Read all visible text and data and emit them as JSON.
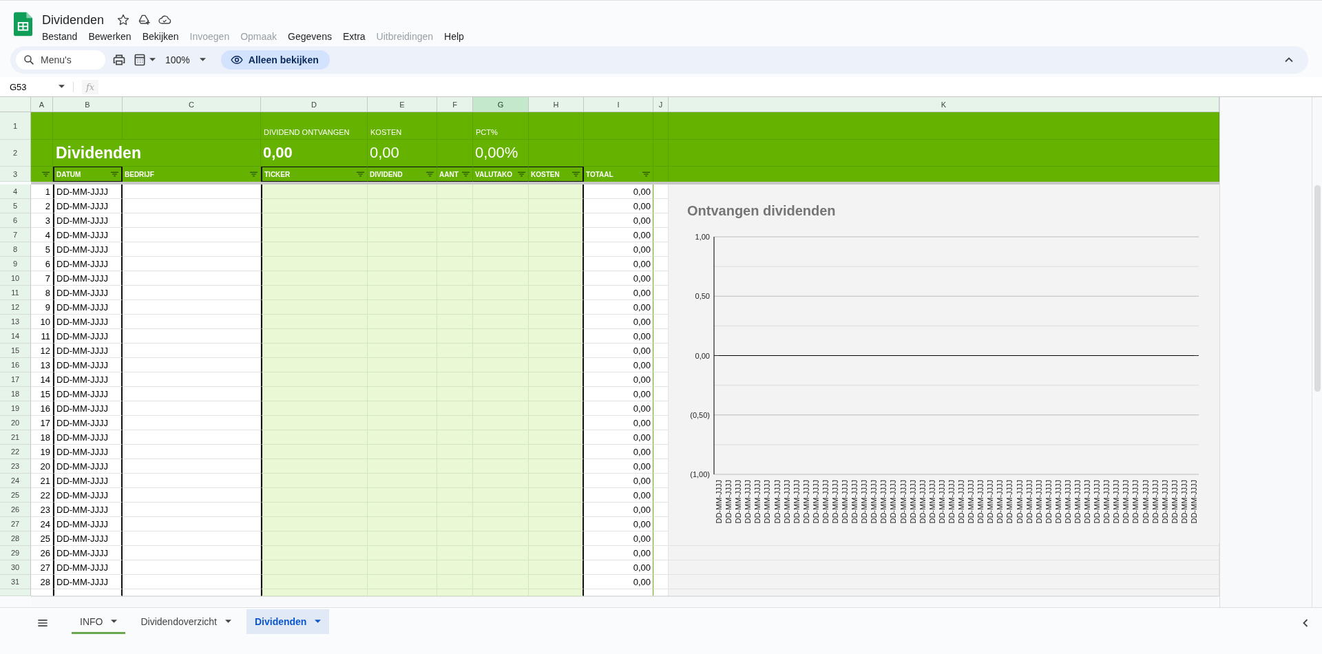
{
  "document": {
    "title": "Dividenden"
  },
  "menu": [
    {
      "label": "Bestand",
      "disabled": false
    },
    {
      "label": "Bewerken",
      "disabled": false
    },
    {
      "label": "Bekijken",
      "disabled": false
    },
    {
      "label": "Invoegen",
      "disabled": true
    },
    {
      "label": "Opmaak",
      "disabled": true
    },
    {
      "label": "Gegevens",
      "disabled": false
    },
    {
      "label": "Extra",
      "disabled": false
    },
    {
      "label": "Uitbreidingen",
      "disabled": true
    },
    {
      "label": "Help",
      "disabled": false
    }
  ],
  "toolbar": {
    "search_placeholder": "Menu's",
    "zoom": "100%",
    "mode_chip": "Alleen bekijken"
  },
  "formula_bar": {
    "name_box": "G53",
    "fx": "fx"
  },
  "sheet": {
    "columns": [
      {
        "label": "A",
        "selected": false
      },
      {
        "label": "B",
        "selected": false
      },
      {
        "label": "C",
        "selected": false
      },
      {
        "label": "D",
        "selected": false
      },
      {
        "label": "E",
        "selected": false
      },
      {
        "label": "F",
        "selected": false
      },
      {
        "label": "G",
        "selected": true
      },
      {
        "label": "H",
        "selected": false
      },
      {
        "label": "I",
        "selected": false
      },
      {
        "label": "J",
        "selected": false
      },
      {
        "label": "K",
        "selected": false
      }
    ],
    "top_row_numbers": [
      "1",
      "2",
      "3"
    ],
    "title": "Dividenden",
    "summary": [
      {
        "label": "DIVIDEND ONTVANGEN",
        "value": "0,00",
        "bold": true
      },
      {
        "label": "KOSTEN",
        "value": "0,00",
        "bold": false
      },
      {
        "label": "PCT%",
        "value": "0,00%",
        "bold": false
      }
    ],
    "headers": [
      "DATUM",
      "BEDRIJF",
      "TICKER",
      "DIVIDEND",
      "AANT",
      "VALUTAKO",
      "KOSTEN",
      "TOTAAL"
    ],
    "rows": [
      {
        "row_number": "4",
        "index": "1",
        "date": "DD-MM-JJJJ",
        "total": "0,00"
      },
      {
        "row_number": "5",
        "index": "2",
        "date": "DD-MM-JJJJ",
        "total": "0,00"
      },
      {
        "row_number": "6",
        "index": "3",
        "date": "DD-MM-JJJJ",
        "total": "0,00"
      },
      {
        "row_number": "7",
        "index": "4",
        "date": "DD-MM-JJJJ",
        "total": "0,00"
      },
      {
        "row_number": "8",
        "index": "5",
        "date": "DD-MM-JJJJ",
        "total": "0,00"
      },
      {
        "row_number": "9",
        "index": "6",
        "date": "DD-MM-JJJJ",
        "total": "0,00"
      },
      {
        "row_number": "10",
        "index": "7",
        "date": "DD-MM-JJJJ",
        "total": "0,00"
      },
      {
        "row_number": "11",
        "index": "8",
        "date": "DD-MM-JJJJ",
        "total": "0,00"
      },
      {
        "row_number": "12",
        "index": "9",
        "date": "DD-MM-JJJJ",
        "total": "0,00"
      },
      {
        "row_number": "13",
        "index": "10",
        "date": "DD-MM-JJJJ",
        "total": "0,00"
      },
      {
        "row_number": "14",
        "index": "11",
        "date": "DD-MM-JJJJ",
        "total": "0,00"
      },
      {
        "row_number": "15",
        "index": "12",
        "date": "DD-MM-JJJJ",
        "total": "0,00"
      },
      {
        "row_number": "16",
        "index": "13",
        "date": "DD-MM-JJJJ",
        "total": "0,00"
      },
      {
        "row_number": "17",
        "index": "14",
        "date": "DD-MM-JJJJ",
        "total": "0,00"
      },
      {
        "row_number": "18",
        "index": "15",
        "date": "DD-MM-JJJJ",
        "total": "0,00"
      },
      {
        "row_number": "19",
        "index": "16",
        "date": "DD-MM-JJJJ",
        "total": "0,00"
      },
      {
        "row_number": "20",
        "index": "17",
        "date": "DD-MM-JJJJ",
        "total": "0,00"
      },
      {
        "row_number": "21",
        "index": "18",
        "date": "DD-MM-JJJJ",
        "total": "0,00"
      },
      {
        "row_number": "22",
        "index": "19",
        "date": "DD-MM-JJJJ",
        "total": "0,00"
      },
      {
        "row_number": "23",
        "index": "20",
        "date": "DD-MM-JJJJ",
        "total": "0,00"
      },
      {
        "row_number": "24",
        "index": "21",
        "date": "DD-MM-JJJJ",
        "total": "0,00"
      },
      {
        "row_number": "25",
        "index": "22",
        "date": "DD-MM-JJJJ",
        "total": "0,00"
      },
      {
        "row_number": "26",
        "index": "23",
        "date": "DD-MM-JJJJ",
        "total": "0,00"
      },
      {
        "row_number": "27",
        "index": "24",
        "date": "DD-MM-JJJJ",
        "total": "0,00"
      },
      {
        "row_number": "28",
        "index": "25",
        "date": "DD-MM-JJJJ",
        "total": "0,00"
      },
      {
        "row_number": "29",
        "index": "26",
        "date": "DD-MM-JJJJ",
        "total": "0,00"
      },
      {
        "row_number": "30",
        "index": "27",
        "date": "DD-MM-JJJJ",
        "total": "0,00"
      },
      {
        "row_number": "31",
        "index": "28",
        "date": "DD-MM-JJJJ",
        "total": "0,00"
      }
    ],
    "chart": {
      "chart_data": {
        "type": "line",
        "title": "Ontvangen dividenden",
        "categories": [
          "DD-MM-JJJJ",
          "DD-MM-JJJJ",
          "DD-MM-JJJJ",
          "DD-MM-JJJJ",
          "DD-MM-JJJJ",
          "DD-MM-JJJJ",
          "DD-MM-JJJJ",
          "DD-MM-JJJJ",
          "DD-MM-JJJJ",
          "DD-MM-JJJJ",
          "DD-MM-JJJJ",
          "DD-MM-JJJJ",
          "DD-MM-JJJJ",
          "DD-MM-JJJJ",
          "DD-MM-JJJJ",
          "DD-MM-JJJJ",
          "DD-MM-JJJJ",
          "DD-MM-JJJJ",
          "DD-MM-JJJJ",
          "DD-MM-JJJJ",
          "DD-MM-JJJJ",
          "DD-MM-JJJJ",
          "DD-MM-JJJJ",
          "DD-MM-JJJJ",
          "DD-MM-JJJJ",
          "DD-MM-JJJJ",
          "DD-MM-JJJJ",
          "DD-MM-JJJJ",
          "DD-MM-JJJJ",
          "DD-MM-JJJJ",
          "DD-MM-JJJJ",
          "DD-MM-JJJJ",
          "DD-MM-JJJJ",
          "DD-MM-JJJJ",
          "DD-MM-JJJJ",
          "DD-MM-JJJJ",
          "DD-MM-JJJJ",
          "DD-MM-JJJJ",
          "DD-MM-JJJJ",
          "DD-MM-JJJJ",
          "DD-MM-JJJJ",
          "DD-MM-JJJJ",
          "DD-MM-JJJJ",
          "DD-MM-JJJJ",
          "DD-MM-JJJJ",
          "DD-MM-JJJJ",
          "DD-MM-JJJJ",
          "DD-MM-JJJJ",
          "DD-MM-JJJJ",
          "DD-MM-JJJJ"
        ],
        "series": [
          {
            "color": "#000000",
            "values": [
              0,
              0,
              0,
              0,
              0,
              0,
              0,
              0,
              0,
              0,
              0,
              0,
              0,
              0,
              0,
              0,
              0,
              0,
              0,
              0,
              0,
              0,
              0,
              0,
              0,
              0,
              0,
              0,
              0,
              0,
              0,
              0,
              0,
              0,
              0,
              0,
              0,
              0,
              0,
              0,
              0,
              0,
              0,
              0,
              0,
              0,
              0,
              0,
              0,
              0
            ]
          }
        ],
        "ylim": [
          -1,
          1
        ],
        "yticks": [
          {
            "value": 1,
            "label": "1,00"
          },
          {
            "value": 0.5,
            "label": "0,50"
          },
          {
            "value": 0,
            "label": "0,00"
          },
          {
            "value": -0.5,
            "label": "(0,50)"
          },
          {
            "value": -1,
            "label": "(1,00)"
          }
        ]
      }
    }
  },
  "sheet_tabs": [
    {
      "label": "INFO",
      "selected": false,
      "color": "#6aa84f"
    },
    {
      "label": "Dividendoverzicht",
      "selected": false
    },
    {
      "label": "Dividenden",
      "selected": true
    }
  ]
}
